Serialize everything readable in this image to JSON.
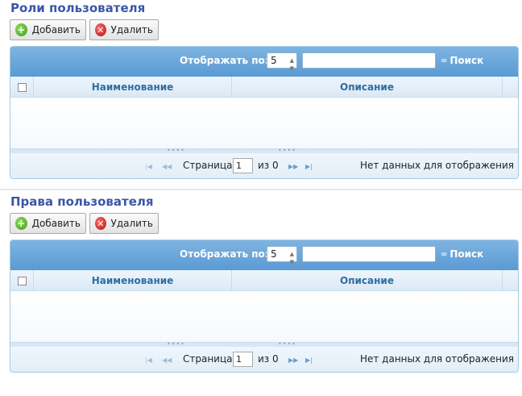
{
  "sections": [
    {
      "title": "Роли пользователя",
      "add_label": "Добавить",
      "delete_label": "Удалить",
      "grid": {
        "per_page_label": "Отображать по:",
        "per_page_value": "5",
        "search_label": "Поиск",
        "columns": [
          "Наименование",
          "Описание"
        ],
        "rows": [],
        "pager": {
          "page_label": "Страница",
          "page_value": "1",
          "of_label": "из 0",
          "info": "Нет данных для отображения"
        }
      }
    },
    {
      "title": "Права пользователя",
      "add_label": "Добавить",
      "delete_label": "Удалить",
      "grid": {
        "per_page_label": "Отображать по:",
        "per_page_value": "5",
        "search_label": "Поиск",
        "columns": [
          "Наименование",
          "Описание"
        ],
        "rows": [],
        "pager": {
          "page_label": "Страница",
          "page_value": "1",
          "of_label": "из 0",
          "info": "Нет данных для отображения"
        }
      }
    }
  ],
  "icons": {
    "add": "plus-circle-icon",
    "delete": "x-circle-icon",
    "search": "binoculars-icon"
  },
  "colors": {
    "title": "#3b56a8",
    "grid_header": "#5a9ad3",
    "column_header_text": "#2e6e9e",
    "add_icon": "#3f9a1e",
    "delete_icon": "#b01515"
  }
}
